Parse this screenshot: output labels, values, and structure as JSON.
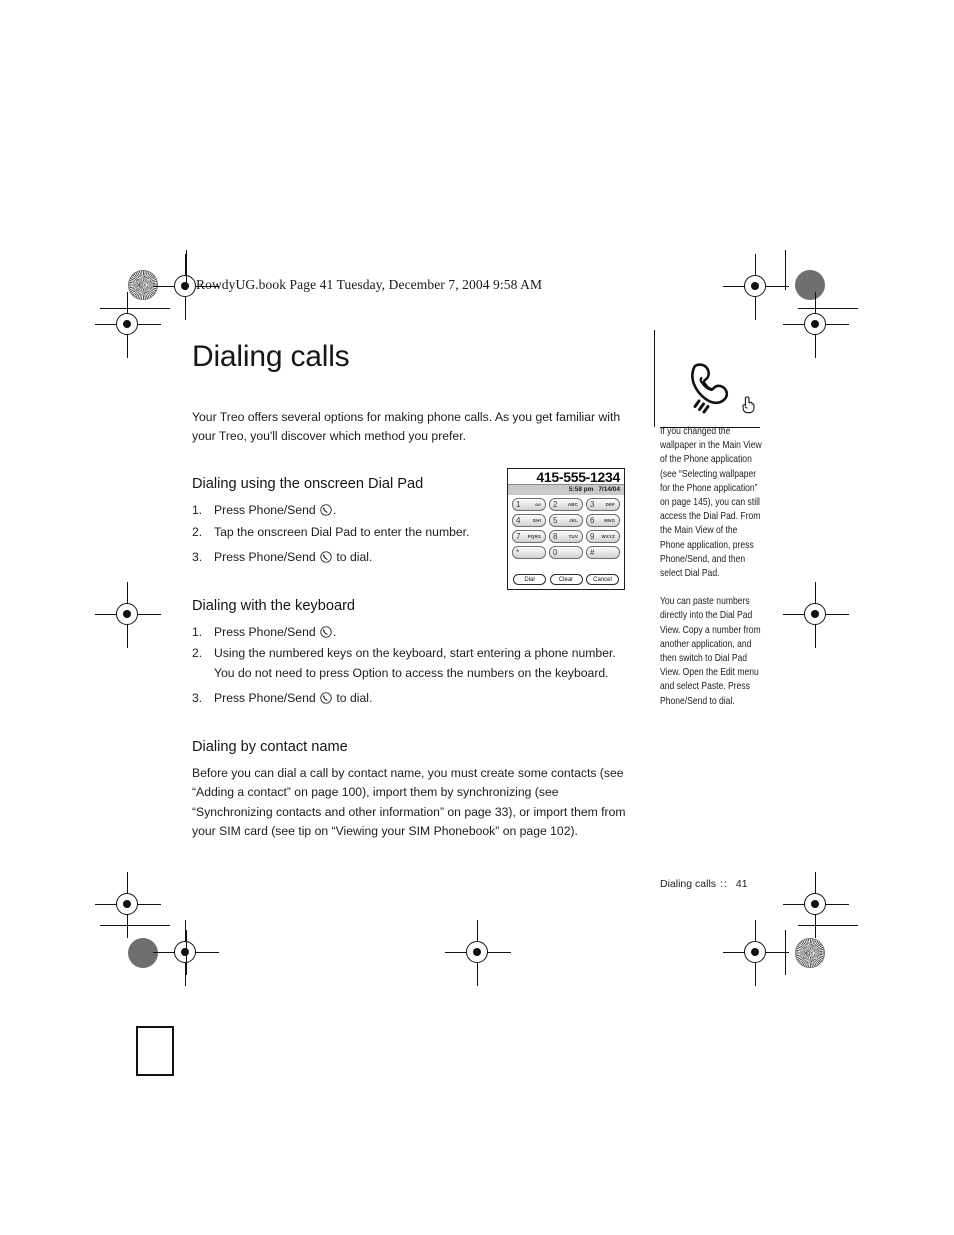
{
  "book_header": "RowdyUG.book  Page 41  Tuesday, December 7, 2004  9:58 AM",
  "page_title": "Dialing calls",
  "intro": "Your Treo offers several options for making phone calls. As you get familiar with your Treo, you'll discover which method you prefer.",
  "sections": [
    {
      "heading": "Dialing using the onscreen Dial Pad",
      "steps": [
        {
          "num": "1.",
          "pre": "Press Phone/Send ",
          "post": "."
        },
        {
          "num": "2.",
          "pre": "Tap the onscreen Dial Pad to enter the number.",
          "post": ""
        },
        {
          "num": "3.",
          "pre": "Press Phone/Send ",
          "post": " to dial."
        }
      ]
    },
    {
      "heading": "Dialing with the keyboard",
      "steps": [
        {
          "num": "1.",
          "pre": "Press Phone/Send ",
          "post": "."
        },
        {
          "num": "2.",
          "pre": "Using the numbered keys on the keyboard, start entering a phone number. You do not need to press Option to access the numbers on the keyboard.",
          "post": ""
        },
        {
          "num": "3.",
          "pre": "Press Phone/Send ",
          "post": " to dial."
        }
      ]
    },
    {
      "heading": "Dialing by contact name",
      "paragraph": "Before you can dial a call by contact name, you must create some contacts (see “Adding a contact” on page 100), import them by synchronizing (see “Synchronizing contacts and other information” on page 33), or import them from your SIM card (see tip on “Viewing your SIM Phonebook” on page 102)."
    }
  ],
  "dialpad": {
    "number": "415-555-1234",
    "time": "5:58 pm",
    "date": "7/14/04",
    "keys": [
      {
        "digit": "1",
        "letters": "oo"
      },
      {
        "digit": "2",
        "letters": "ABC"
      },
      {
        "digit": "3",
        "letters": "DEF"
      },
      {
        "digit": "4",
        "letters": "GHI"
      },
      {
        "digit": "5",
        "letters": "JKL"
      },
      {
        "digit": "6",
        "letters": "MNO"
      },
      {
        "digit": "7",
        "letters": "PQRS"
      },
      {
        "digit": "8",
        "letters": "TUV"
      },
      {
        "digit": "9",
        "letters": "WXYZ"
      },
      {
        "digit": "*",
        "letters": ""
      },
      {
        "digit": "0",
        "letters": ""
      },
      {
        "digit": "#",
        "letters": ""
      }
    ],
    "buttons": [
      "Dial",
      "Clear",
      "Cancel"
    ]
  },
  "sidebar": {
    "tips": [
      "If you changed the wallpaper in the Main View of the Phone application (see “Selecting wallpaper for the Phone application” on page 145), you can still access the Dial Pad. From the Main View of the Phone application, press Phone/Send, and then select Dial Pad.",
      "You can paste numbers directly into the Dial Pad View. Copy a number from another application, and then switch to Dial Pad View. Open the Edit menu and select Paste. Press Phone/Send to dial."
    ]
  },
  "footer": {
    "chapter": "Dialing calls",
    "separator": "::",
    "page_number": "41"
  }
}
